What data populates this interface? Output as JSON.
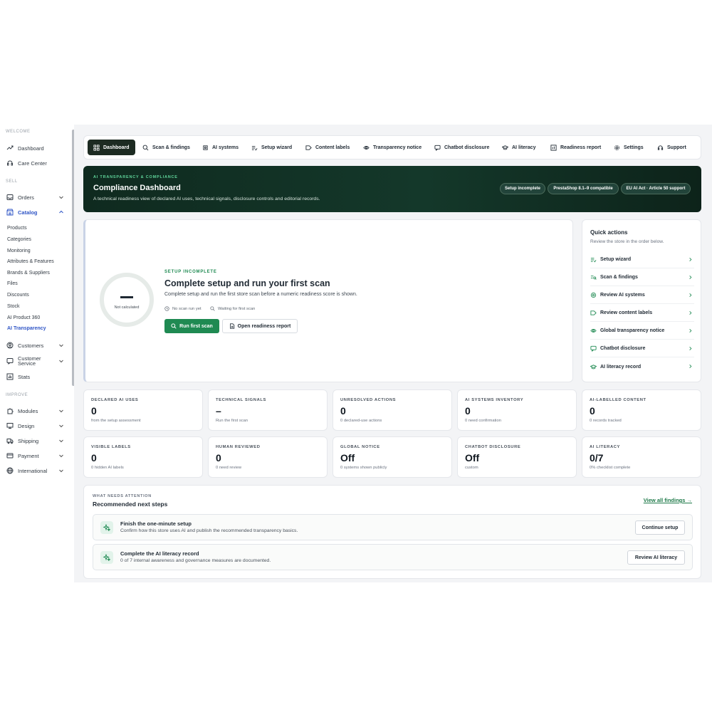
{
  "sidebar": {
    "sections": {
      "welcome": "WELCOME",
      "sell": "SELL",
      "improve": "IMPROVE"
    },
    "welcome_items": [
      {
        "label": "Dashboard",
        "icon": "trending-up-icon"
      },
      {
        "label": "Care Center",
        "icon": "headset-icon"
      }
    ],
    "orders": "Orders",
    "catalog": "Catalog",
    "catalog_sub": [
      "Products",
      "Categories",
      "Monitoring",
      "Attributes & Features",
      "Brands & Suppliers",
      "Files",
      "Discounts",
      "Stock",
      "AI Product 360",
      "AI Transparency"
    ],
    "customers": "Customers",
    "customer_service_1": "Customer",
    "customer_service_2": "Service",
    "stats": "Stats",
    "modules": "Modules",
    "design": "Design",
    "shipping": "Shipping",
    "payment": "Payment",
    "international": "International"
  },
  "nav": {
    "tabs": [
      "Dashboard",
      "Scan & findings",
      "AI systems",
      "Setup wizard",
      "Content labels",
      "Transparency notice",
      "Chatbot disclosure",
      "AI literacy",
      "Readiness report",
      "Settings",
      "Support"
    ]
  },
  "hero": {
    "eyebrow": "AI TRANSPARENCY & COMPLIANCE",
    "title": "Compliance Dashboard",
    "subtitle": "A technical readiness view of declared AI uses, technical signals, disclosure controls and editorial records.",
    "pills": [
      "Setup incomplete",
      "PrestaShop 8.1–9 compatible",
      "EU AI Act · Article 50 support"
    ]
  },
  "score": {
    "value": "–",
    "caption": "Not calculated",
    "eyebrow": "SETUP INCOMPLETE",
    "title": "Complete setup and run your first scan",
    "text": "Complete setup and run the first store scan before a numeric readiness score is shown.",
    "meta": [
      "No scan run yet",
      "Waiting for first scan"
    ],
    "primary": "Run first scan",
    "secondary": "Open readiness report"
  },
  "quick_actions": {
    "title": "Quick actions",
    "subtitle": "Review the store in the order below.",
    "items": [
      "Setup wizard",
      "Scan & findings",
      "Review AI systems",
      "Review content labels",
      "Global transparency notice",
      "Chatbot disclosure",
      "AI literacy record"
    ]
  },
  "stats": [
    {
      "label": "DECLARED AI USES",
      "value": "0",
      "sub": "from the setup assessment"
    },
    {
      "label": "TECHNICAL SIGNALS",
      "value": "–",
      "sub": "Run the first scan"
    },
    {
      "label": "UNRESOLVED ACTIONS",
      "value": "0",
      "sub": "0 declared-use actions"
    },
    {
      "label": "AI SYSTEMS INVENTORY",
      "value": "0",
      "sub": "0 need confirmation"
    },
    {
      "label": "AI-LABELLED CONTENT",
      "value": "0",
      "sub": "0 records tracked"
    },
    {
      "label": "VISIBLE LABELS",
      "value": "0",
      "sub": "0 hidden AI labels"
    },
    {
      "label": "HUMAN REVIEWED",
      "value": "0",
      "sub": "0 need review"
    },
    {
      "label": "GLOBAL NOTICE",
      "value": "Off",
      "sub": "0 systems shown publicly"
    },
    {
      "label": "CHATBOT DISCLOSURE",
      "value": "Off",
      "sub": "custom"
    },
    {
      "label": "AI LITERACY",
      "value": "0/7",
      "sub": "0% checklist complete"
    }
  ],
  "recommended": {
    "eyebrow": "WHAT NEEDS ATTENTION",
    "title": "Recommended next steps",
    "link": "View all findings →",
    "rows": [
      {
        "title": "Finish the one-minute setup",
        "desc": "Confirm how this store uses AI and publish the recommended transparency basics.",
        "button": "Continue setup"
      },
      {
        "title": "Complete the AI literacy record",
        "desc": "0 of 7 internal awareness and governance measures are documented.",
        "button": "Review AI literacy"
      }
    ]
  },
  "colors": {
    "accent_green": "#1f8a52",
    "hero_dark": "#14382a",
    "active_blue": "#2f55c6"
  }
}
